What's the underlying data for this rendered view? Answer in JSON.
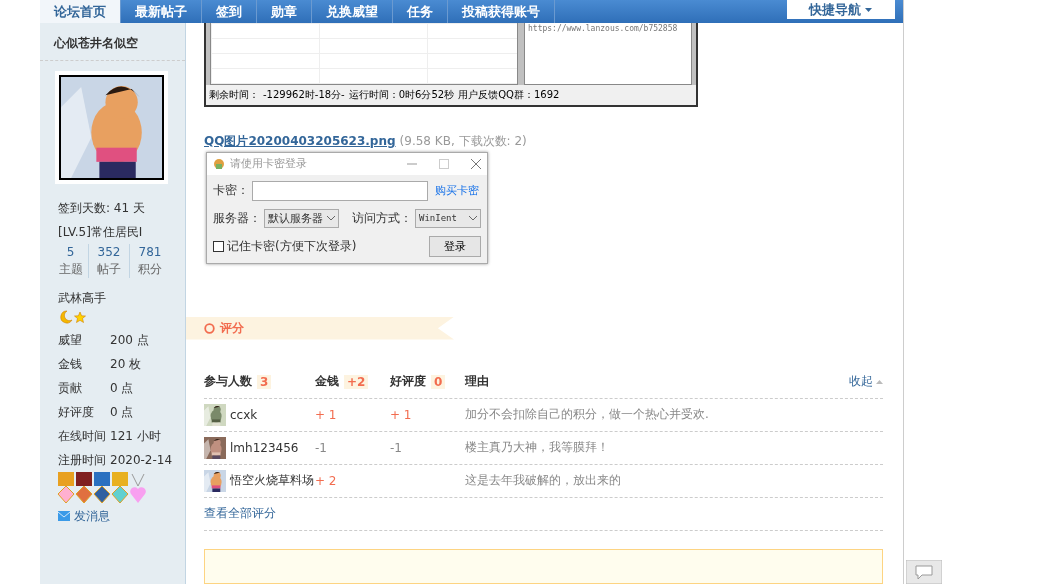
{
  "nav": {
    "tabs": [
      {
        "label": "论坛首页",
        "selected": true
      },
      {
        "label": "最新帖子",
        "selected": false
      },
      {
        "label": "签到",
        "selected": false
      },
      {
        "label": "勋章",
        "selected": false
      },
      {
        "label": "兑换威望",
        "selected": false
      },
      {
        "label": "任务",
        "selected": false
      },
      {
        "label": "投稿获得账号",
        "selected": false
      }
    ],
    "quick_nav": "快捷导航"
  },
  "sidebar": {
    "username": "心似苍井名似空",
    "checkin": "签到天数: 41 天",
    "level": "[LV.5]常住居民I",
    "stats": [
      {
        "value": "5",
        "label": "主题"
      },
      {
        "value": "352",
        "label": "帖子"
      },
      {
        "value": "781",
        "label": "积分"
      }
    ],
    "rank": "武林高手",
    "info": [
      {
        "label": "威望",
        "value": "200 点"
      },
      {
        "label": "金钱",
        "value": "20 枚"
      },
      {
        "label": "贡献",
        "value": "0 点"
      },
      {
        "label": "好评度",
        "value": "0 点"
      },
      {
        "label": "在线时间",
        "value": "121 小时"
      },
      {
        "label": "注册时间",
        "value": "2020-2-14"
      }
    ],
    "send_message": "发消息"
  },
  "post": {
    "screenshot": {
      "url": "https://www.lanzous.com/b752858",
      "status": [
        "剩余时间：",
        "-129962时-18分-",
        "运行时间：0时6分52秒",
        "用户反馈QQ群：1692"
      ]
    },
    "attachment": {
      "name": "QQ图片20200403205623.png",
      "meta": "(9.58 KB, 下载次数: 2)"
    },
    "login_window": {
      "title": "请使用卡密登录",
      "key_label": "卡密：",
      "buy_link": "购买卡密",
      "server_label": "服务器：",
      "server_value": "默认服务器",
      "access_label": "访问方式：",
      "access_value": "WinIent",
      "remember_label": "记住卡密(方便下次登录)",
      "remember_checked": false,
      "login_button": "登录"
    }
  },
  "rating": {
    "title": "评分",
    "columns": [
      {
        "label": "参与人数",
        "badge": "3"
      },
      {
        "label": "金钱",
        "badge": "+2"
      },
      {
        "label": "好评度",
        "badge": "0"
      },
      {
        "label": "理由"
      }
    ],
    "collapse": "收起",
    "rows": [
      {
        "user": "ccxk",
        "money": {
          "text": "+ 1",
          "kind": "gain"
        },
        "rep": {
          "text": "+ 1",
          "kind": "gain"
        },
        "reason": "加分不会扣除自己的积分，做一个热心并受欢."
      },
      {
        "user": "lmh123456",
        "money": {
          "text": "-1",
          "kind": "loss"
        },
        "rep": {
          "text": "-1",
          "kind": "loss"
        },
        "reason": "楼主真乃大神，我等膜拜！"
      },
      {
        "user": "悟空火烧草料场",
        "money": {
          "text": "+ 2",
          "kind": "gain"
        },
        "reason": "这是去年我破解的，放出来的"
      }
    ],
    "view_all": "查看全部评分"
  }
}
